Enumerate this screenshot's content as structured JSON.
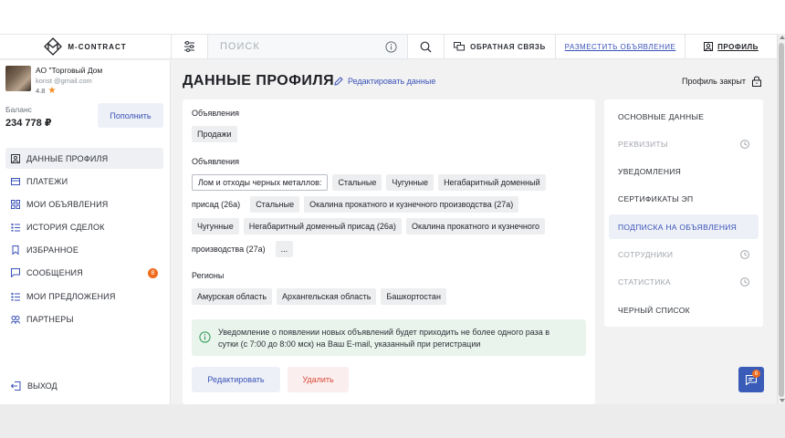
{
  "header": {
    "logo_text": "M-CONTRACT",
    "search_placeholder": "ПОИСК",
    "feedback_label": "ОБРАТНАЯ СВЯЗЬ",
    "place_ad_label": "РАЗМЕСТИТЬ ОБЪЯВЛЕНИЕ",
    "profile_label": "ПРОФИЛЬ"
  },
  "user": {
    "name": "АО \"Торговый Дом",
    "email": "konst  @gmail.com",
    "rating": "4.8"
  },
  "balance": {
    "label": "Баланс",
    "value": "234 778 ₽",
    "topup_label": "Пополнить"
  },
  "sidebar": {
    "items": [
      {
        "label": "ДАННЫЕ ПРОФИЛЯ",
        "icon": "profile-icon"
      },
      {
        "label": "ПЛАТЕЖИ",
        "icon": "wallet-icon"
      },
      {
        "label": "МОИ ОБЪЯВЛЕНИЯ",
        "icon": "grid-icon"
      },
      {
        "label": "ИСТОРИЯ СДЕЛОК",
        "icon": "list-icon"
      },
      {
        "label": "ИЗБРАННОЕ",
        "icon": "bookmark-icon"
      },
      {
        "label": "СООБЩЕНИЯ",
        "icon": "chat-icon",
        "badge": "8"
      },
      {
        "label": "МОИ ПРЕДЛОЖЕНИЯ",
        "icon": "offers-icon"
      },
      {
        "label": "ПАРТНЕРЫ",
        "icon": "partners-icon"
      }
    ],
    "logout_label": "ВЫХОД"
  },
  "main": {
    "title": "ДАННЫЕ ПРОФИЛЯ",
    "edit_label": "Редактировать данные",
    "closed_label": "Профиль закрыт",
    "section1_label": "Объявления",
    "section1_tags": [
      "Продажи"
    ],
    "section2_label": "Объявления",
    "section2_row1": [
      "Лом и отходы черных металлов:",
      "Стальные",
      "Чугунные",
      "Негабаритный доменный"
    ],
    "section2_row2": [
      "присад (26а)",
      "Стальные",
      "Окалина прокатного и кузнечного производства (27а)"
    ],
    "section2_row3": [
      "Чугунные",
      "Негабаритный доменный присад (26а)",
      "Окалина прокатного и кузнечного"
    ],
    "section2_row4": [
      "производства (27а)",
      "..."
    ],
    "regions_label": "Регионы",
    "regions": [
      "Амурская область",
      "Архангельская область",
      "Башкортостан"
    ],
    "notice_line1": "Уведомление о появлении новых объявлений будет приходить не более одного раза в",
    "notice_line2": "сутки (с 7:00 до 8:00 мск) на Ваш E-mail, указанный при регистрации",
    "edit_button": "Редактировать",
    "delete_button": "Удалить"
  },
  "right_nav": {
    "items": [
      {
        "label": "ОСНОВНЫЕ ДАННЫЕ",
        "state": "normal"
      },
      {
        "label": "РЕКВИЗИТЫ",
        "state": "disabled"
      },
      {
        "label": "УВЕДОМЛЕНИЯ",
        "state": "normal"
      },
      {
        "label": "СЕРТИФИКАТЫ ЭП",
        "state": "normal"
      },
      {
        "label": "ПОДПИСКА НА ОБЪЯВЛЕНИЯ",
        "state": "active"
      },
      {
        "label": "СОТРУДНИКИ",
        "state": "disabled"
      },
      {
        "label": "СТАТИСТИКА",
        "state": "disabled"
      },
      {
        "label": "ЧЕРНЫЙ СПИСОК",
        "state": "normal"
      }
    ]
  },
  "chat_badge": "8",
  "colors": {
    "accent": "#3a52b8",
    "badge": "#f06a1c",
    "danger": "#d94c3a",
    "notice_bg": "#e9f4ec"
  }
}
